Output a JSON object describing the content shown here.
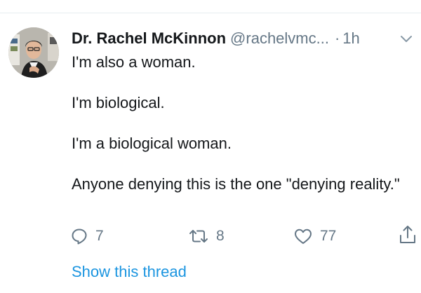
{
  "tweet": {
    "author_name": "Dr. Rachel McKinnon",
    "handle": "@rachelvmc...",
    "separator": "·",
    "time": "1h",
    "paragraphs": [
      "I'm also a woman.",
      "I'm biological.",
      "I'm a biological woman.",
      "Anyone denying this is the one \"denying reality.\""
    ]
  },
  "actions": {
    "reply_count": "7",
    "retweet_count": "8",
    "like_count": "77"
  },
  "footer": {
    "show_thread_label": "Show this thread"
  },
  "colors": {
    "text": "#14171a",
    "secondary": "#657786",
    "link": "#1b95e0",
    "divider": "#e6ecf0"
  },
  "icons": [
    "avatar-photo",
    "chevron-down-icon",
    "reply-icon",
    "retweet-icon",
    "heart-icon",
    "share-icon"
  ]
}
